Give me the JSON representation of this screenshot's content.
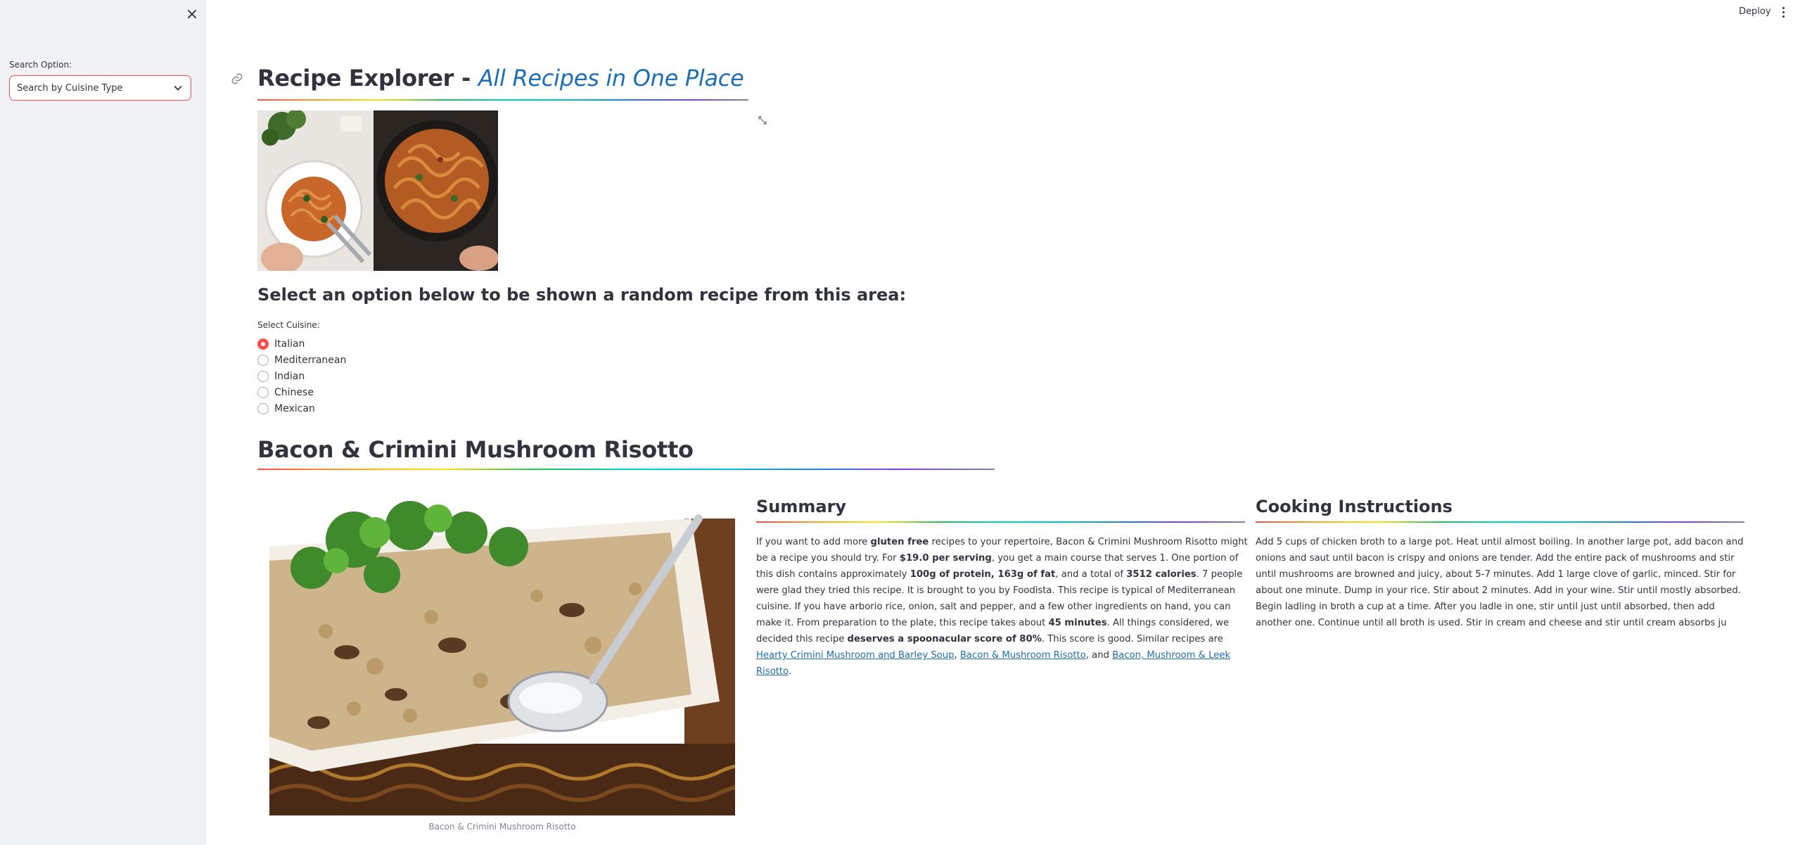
{
  "sidebar": {
    "close_glyph": "×",
    "search_label": "Search Option:",
    "search_value": "Search by Cuisine Type"
  },
  "header": {
    "deploy_label": "Deploy"
  },
  "page": {
    "title_main": "Recipe Explorer",
    "title_sep": " - ",
    "title_sub": "All Recipes in One Place",
    "prompt": "Select an option below to be shown a random recipe from this area:",
    "cuisine_label": "Select Cuisine:",
    "cuisines": [
      "Italian",
      "Mediterranean",
      "Indian",
      "Chinese",
      "Mexican"
    ],
    "selected_cuisine": "Italian"
  },
  "recipe": {
    "title": "Bacon & Crimini Mushroom Risotto",
    "image_caption": "Bacon & Crimini Mushroom Risotto",
    "summary_heading": "Summary",
    "summary": {
      "t1": "If you want to add more ",
      "b1": "gluten free",
      "t2": " recipes to your repertoire, Bacon & Crimini Mushroom Risotto might be a recipe you should try. For ",
      "b2": "$19.0 per serving",
      "t3": ", you get a main course that serves 1. One portion of this dish contains approximately ",
      "b3": "100g of protein, 163g of fat",
      "t4": ", and a total of ",
      "b4": "3512 calories",
      "t5": ". 7 people were glad they tried this recipe. It is brought to you by Foodista. This recipe is typical of Mediterranean cuisine. If you have arborio rice, onion, salt and pepper, and a few other ingredients on hand, you can make it. From preparation to the plate, this recipe takes about ",
      "b5": "45 minutes",
      "t6": ". All things considered, we decided this recipe ",
      "b6": "deserves a spoonacular score of 80%",
      "t7": ". This score is good. Similar recipes are ",
      "link1": "Hearty Crimini Mushroom and Barley Soup",
      "t8": ", ",
      "link2": "Bacon & Mushroom Risotto",
      "t9": ", and ",
      "link3": "Bacon, Mushroom & Leek Risotto",
      "t10": "."
    },
    "instructions_heading": "Cooking Instructions",
    "instructions": "Add 5 cups of chicken broth to a large pot. Heat until almost boiling. In another large pot, add bacon and onions and saut until bacon is crispy and onions are tender. Add the entire pack of mushrooms and stir until mushrooms are browned and juicy, about 5-7 minutes. Add 1 large clove of garlic, minced. Stir for about one minute. Dump in your rice. Stir about 2 minutes. Add in your wine. Stir until mostly absorbed. Begin ladling in broth a cup at a time. After you ladle in one, stir until just until absorbed, then add another one. Continue until all broth is used. Stir in cream and cheese and stir until cream absorbs ju"
  },
  "icons": {
    "close": "close-icon",
    "select_chevron": "chevron-down-icon",
    "menu": "kebab-menu-icon",
    "anchor": "link-icon",
    "expand": "fullscreen-icon"
  },
  "colors": {
    "accent": "#ff4b4b",
    "link": "#1c6fb5",
    "sidebar_bg": "#f0f2f6",
    "text": "#31333f"
  }
}
